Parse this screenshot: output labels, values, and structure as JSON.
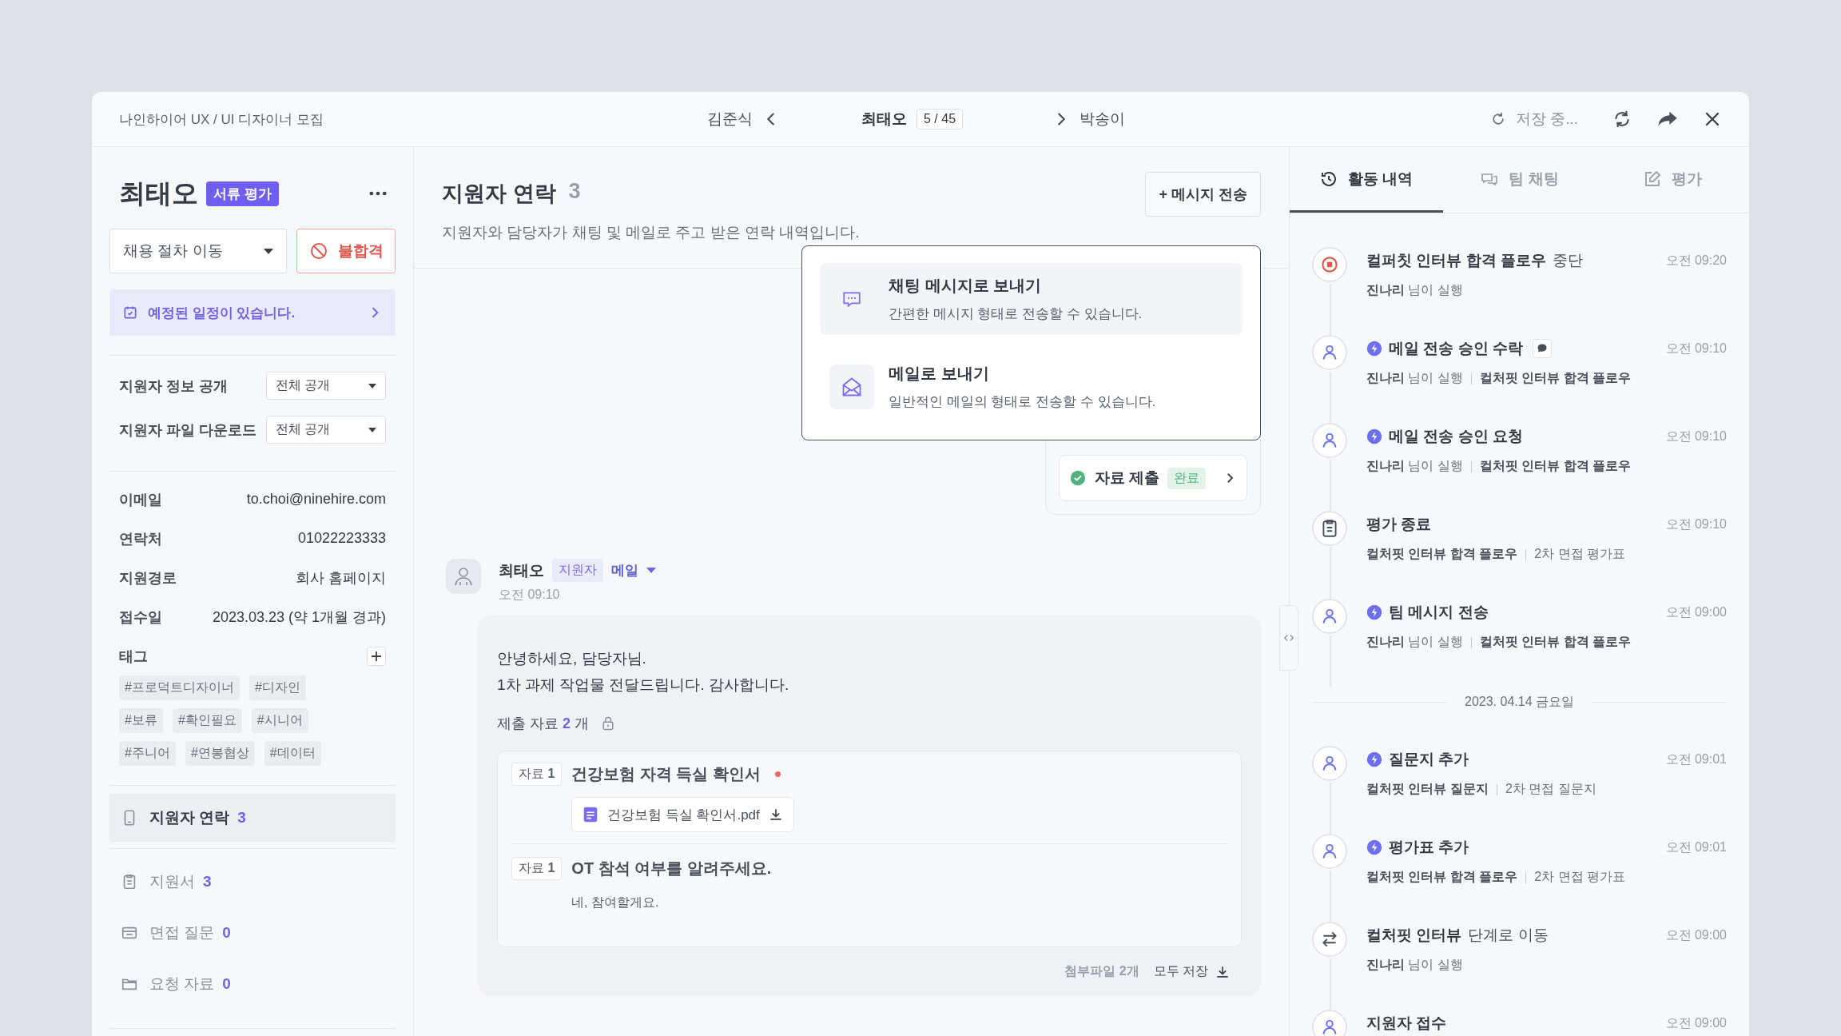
{
  "topbar": {
    "job_title": "나인하이어 UX / UI 디자이너 모집",
    "prev_name": "김준식",
    "current_name": "최태오",
    "position": "5 / 45",
    "next_name": "박송이",
    "save_status": "저장 중..."
  },
  "profile": {
    "name": "최태오",
    "stage_badge": "서류 평가",
    "stage_select": "채용 절차 이동",
    "reject_button": "불합격",
    "schedule_notice": "예정된 일정이 있습니다.",
    "settings": [
      {
        "label": "지원자 정보 공개",
        "value": "전체 공개"
      },
      {
        "label": "지원자 파일 다운로드",
        "value": "전체 공개"
      }
    ],
    "info": [
      {
        "label": "이메일",
        "value": "to.choi@ninehire.com"
      },
      {
        "label": "연락처",
        "value": "01022223333"
      },
      {
        "label": "지원경로",
        "value": "회사 홈페이지"
      },
      {
        "label": "접수일",
        "value": "2023.03.23 (약 1개월 경과)"
      }
    ],
    "tags_label": "태그",
    "tags": [
      "#프로덕트디자이너",
      "#디자인",
      "#보류",
      "#확인필요",
      "#시니어",
      "#주니어",
      "#연봉협상",
      "#데이터"
    ],
    "nav": [
      {
        "kind": "phone",
        "label": "지원자 연락",
        "count": "3",
        "selected": true
      },
      {
        "kind": "clipboard",
        "label": "지원서",
        "count": "3",
        "selected": false
      },
      {
        "kind": "card",
        "label": "면접 질문",
        "count": "0",
        "selected": false
      },
      {
        "kind": "folder",
        "label": "요청 자료",
        "count": "0",
        "selected": false
      }
    ]
  },
  "contact": {
    "title": "지원자 연락",
    "count": "3",
    "description": "지원자와 담당자가 채팅 및 메일로 주고 받은 연락 내역입니다.",
    "send_button": "+ 메시지 전송",
    "send_menu": [
      {
        "kind": "chat",
        "title": "채팅 메시지로 보내기",
        "description": "간편한 메시지 형태로 전송할 수 있습니다.",
        "selected": true
      },
      {
        "kind": "mail",
        "title": "메일로 보내기",
        "description": "일반적인 메일의 형태로 전송할 수 있습니다.",
        "selected": false
      }
    ],
    "status_card": {
      "label": "자료 제출",
      "badge": "완료"
    },
    "message": {
      "sender": "최태오",
      "role_badge": "지원자",
      "channel": "메일",
      "time": "오전 09:10",
      "body": [
        "안녕하세요, 담당자님.",
        "1차 과제 작업물 전달드립니다. 감사합니다."
      ],
      "submitted_label": "제출 자료",
      "submitted_count": "2",
      "submitted_unit": "개",
      "items": [
        {
          "tag": "자료 **1**",
          "title": "건강보험 자격 득실 확인서",
          "required": true,
          "file": "건강보험 득실 확인서.pdf"
        },
        {
          "tag": "자료 **1**",
          "title": "OT 참석 여부를 알려주세요.",
          "required": false,
          "answer": "네, 참여할게요."
        }
      ],
      "attachments": "첨부파일 2개",
      "save_all": "모두 저장"
    }
  },
  "activity": {
    "tabs": [
      {
        "kind": "history",
        "label": "활동 내역",
        "selected": true
      },
      {
        "kind": "chat",
        "label": "팀 채팅",
        "selected": false
      },
      {
        "kind": "edit",
        "label": "평가",
        "selected": false
      }
    ],
    "entries": [
      {
        "kind": "stop",
        "auto": false,
        "title": "컬퍼칫 인터뷰 합격 플로우",
        "suffix": "중단",
        "comment": false,
        "time": "오전 09:20",
        "meta": [
          "**진나리** 님이 실행"
        ]
      },
      {
        "kind": "user",
        "auto": true,
        "title": "메일 전송 승인 수락",
        "comment": true,
        "time": "오전 09:10",
        "meta": [
          "**진나리** 님이 실행",
          "**컬처핏 인터뷰 합격 플로우**"
        ]
      },
      {
        "kind": "user",
        "auto": true,
        "title": "메일 전송 승인 요청",
        "comment": false,
        "time": "오전 09:10",
        "meta": [
          "**진나리** 님이 실행",
          "**컬처핏 인터뷰 합격 플로우**"
        ]
      },
      {
        "kind": "clipboard",
        "auto": false,
        "title": "평가 종료",
        "comment": false,
        "time": "오전 09:10",
        "meta": [
          "**컬처핏 인터뷰 합격 플로우**",
          "2차 면접 평가표"
        ]
      },
      {
        "kind": "user",
        "auto": true,
        "title": "팀 메시지 전송",
        "comment": false,
        "time": "오전 09:00",
        "meta": [
          "**진나리** 님이 실행",
          "**컬처핏 인터뷰 합격 플로우**"
        ]
      },
      {
        "kind": "divider",
        "label": "2023. 04.14 금요일"
      },
      {
        "kind": "user",
        "auto": true,
        "title": "질문지 추가",
        "comment": false,
        "time": "오전 09:01",
        "meta": [
          "**컬처핏 인터뷰 질문지**",
          "2차 면접 질문지"
        ]
      },
      {
        "kind": "user",
        "auto": true,
        "title": "평가표 추가",
        "comment": false,
        "time": "오전 09:01",
        "meta": [
          "**컬처핏 인터뷰 합격 플로우**",
          "2차 면접 평가표"
        ]
      },
      {
        "kind": "swap",
        "auto": false,
        "title": "컬처핏 인터뷰",
        "suffix": "단계로 이동",
        "comment": false,
        "time": "오전 09:00",
        "meta": [
          "**진나리** 님이 실행"
        ]
      },
      {
        "kind": "user",
        "auto": false,
        "title": "지원자 접수",
        "comment": false,
        "time": "오전 09:00"
      }
    ]
  }
}
